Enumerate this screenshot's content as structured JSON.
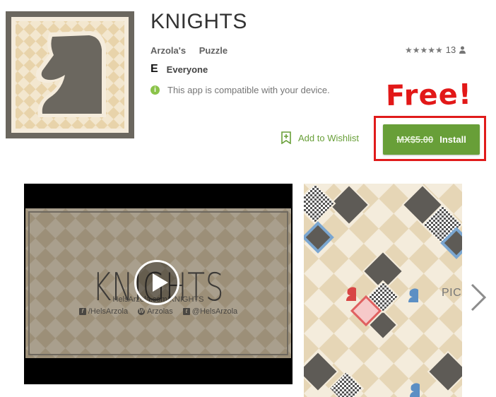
{
  "app": {
    "title": "KNIGHTS",
    "developer": "Arzola's",
    "category": "Puzzle",
    "rating_count": "13",
    "stars": "★★★★★",
    "content_rating_letter": "E",
    "content_rating": "Everyone",
    "compatibility": "This app is compatible with your device.",
    "icon": "knight-chess-piece-icon"
  },
  "annotation": {
    "text": "Free!",
    "color": "#e21818"
  },
  "actions": {
    "wishlist_label": "Add to Wishlist",
    "old_price": "MX$5.00",
    "install_label": "Install"
  },
  "media": {
    "video": {
      "title": "KNIGHTS",
      "subtitle": "HelsArzola.com/KNIGHTS",
      "facebook": "/HelsArzola",
      "wordpress": "Arzolas",
      "twitter": "@HelsArzola"
    },
    "screenshot_label": "PICK I"
  },
  "colors": {
    "accent_green": "#689f38",
    "highlight_red": "#e01b1b",
    "icon_dark": "#6b675f",
    "board_cream": "#f3ead9",
    "board_tan": "#e6d6b6"
  }
}
